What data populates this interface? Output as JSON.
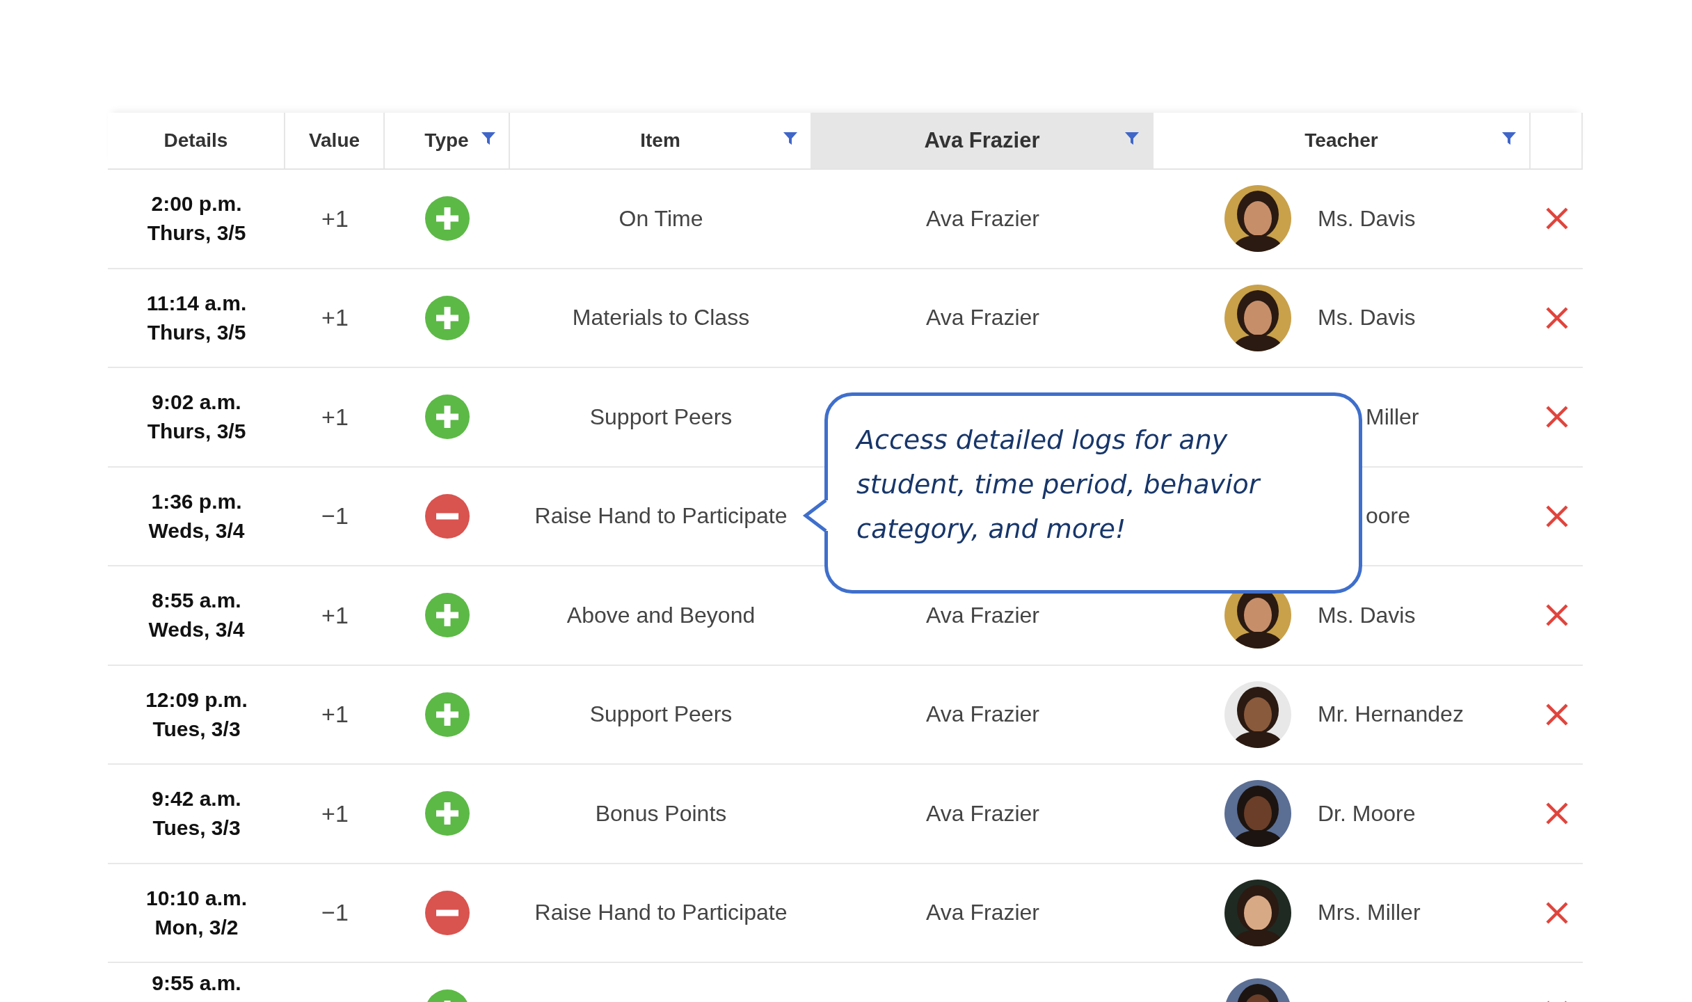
{
  "table": {
    "columns": [
      {
        "label": "Details",
        "filter": false,
        "highlighted": false
      },
      {
        "label": "Value",
        "filter": false,
        "highlighted": false
      },
      {
        "label": "Type",
        "filter": true,
        "highlighted": false
      },
      {
        "label": "Item",
        "filter": true,
        "highlighted": false
      },
      {
        "label": "Ava Frazier",
        "filter": true,
        "highlighted": true
      },
      {
        "label": "Teacher",
        "filter": true,
        "highlighted": false
      }
    ],
    "rows": [
      {
        "time": "2:00 p.m.",
        "day": "Thurs, 3/5",
        "value": "+1",
        "kind": "plus",
        "item": "On Time",
        "student": "Ava Frazier",
        "teacher": "Ms. Davis"
      },
      {
        "time": "11:14 a.m.",
        "day": "Thurs, 3/5",
        "value": "+1",
        "kind": "plus",
        "item": "Materials to Class",
        "student": "Ava Frazier",
        "teacher": "Ms. Davis"
      },
      {
        "time": "9:02 a.m.",
        "day": "Thurs, 3/5",
        "value": "+1",
        "kind": "plus",
        "item": "Support Peers",
        "teacher": "Miller"
      },
      {
        "time": "1:36 p.m.",
        "day": "Weds, 3/4",
        "value": "−1",
        "kind": "minus",
        "item": "Raise Hand to Participate",
        "teacher": "oore"
      },
      {
        "time": "8:55 a.m.",
        "day": "Weds, 3/4",
        "value": "+1",
        "kind": "plus",
        "item": "Above and Beyond",
        "student": "Ava Frazier",
        "teacher": "Ms. Davis"
      },
      {
        "time": "12:09 p.m.",
        "day": "Tues, 3/3",
        "value": "+1",
        "kind": "plus",
        "item": "Support Peers",
        "student": "Ava Frazier",
        "teacher": "Mr. Hernandez"
      },
      {
        "time": "9:42 a.m.",
        "day": "Tues, 3/3",
        "value": "+1",
        "kind": "plus",
        "item": "Bonus Points",
        "student": "Ava Frazier",
        "teacher": "Dr. Moore"
      },
      {
        "time": "10:10 a.m.",
        "day": "Mon, 3/2",
        "value": "−1",
        "kind": "minus",
        "item": "Raise Hand to Participate",
        "student": "Ava Frazier",
        "teacher": "Mrs. Miller"
      },
      {
        "time": "9:55 a.m.",
        "kind": "plus"
      }
    ]
  },
  "callout": {
    "text": "Access detailed logs for any student, time period, behavior category, and more!"
  }
}
